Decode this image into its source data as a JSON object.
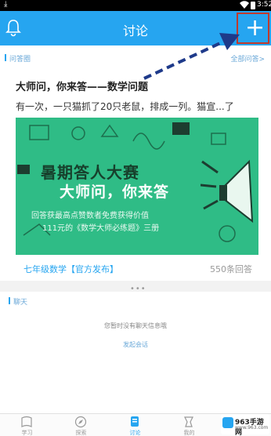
{
  "statusbar": {
    "time": "3:52"
  },
  "header": {
    "title": "讨论"
  },
  "section1": {
    "left_label": "问答圈",
    "right_label": "全部问答>"
  },
  "post": {
    "title": "大师问，你来答——数学问题",
    "excerpt": "有一次，一只猫抓了20只老鼠，排成一列。猫宣...了",
    "banner": {
      "headline1": "暑期答人大赛",
      "headline2": "大师问，你来答",
      "line1": "回答获最高点赞数者免费获得价值",
      "line2": "111元的《数学大师必练题》三册"
    },
    "tag": "七年级数学【官方发布】",
    "count": "550条回答"
  },
  "more_dots": "•••",
  "section2": {
    "label": "聊天",
    "empty_text": "您暂时没有聊天信息哦",
    "start_link": "发起会话"
  },
  "tabs": [
    {
      "label": "学习",
      "icon": "book-icon"
    },
    {
      "label": "探索",
      "icon": "compass-icon"
    },
    {
      "label": "讨论",
      "icon": "chat-icon"
    },
    {
      "label": "我的",
      "icon": "person-icon"
    }
  ],
  "watermark": {
    "line1": "963手游网",
    "line2": "www.963.com"
  },
  "colors": {
    "accent": "#26a5f0",
    "banner_green": "#2fbc86",
    "highlight_border": "#c0392b",
    "arrow": "#1e3a8a"
  }
}
